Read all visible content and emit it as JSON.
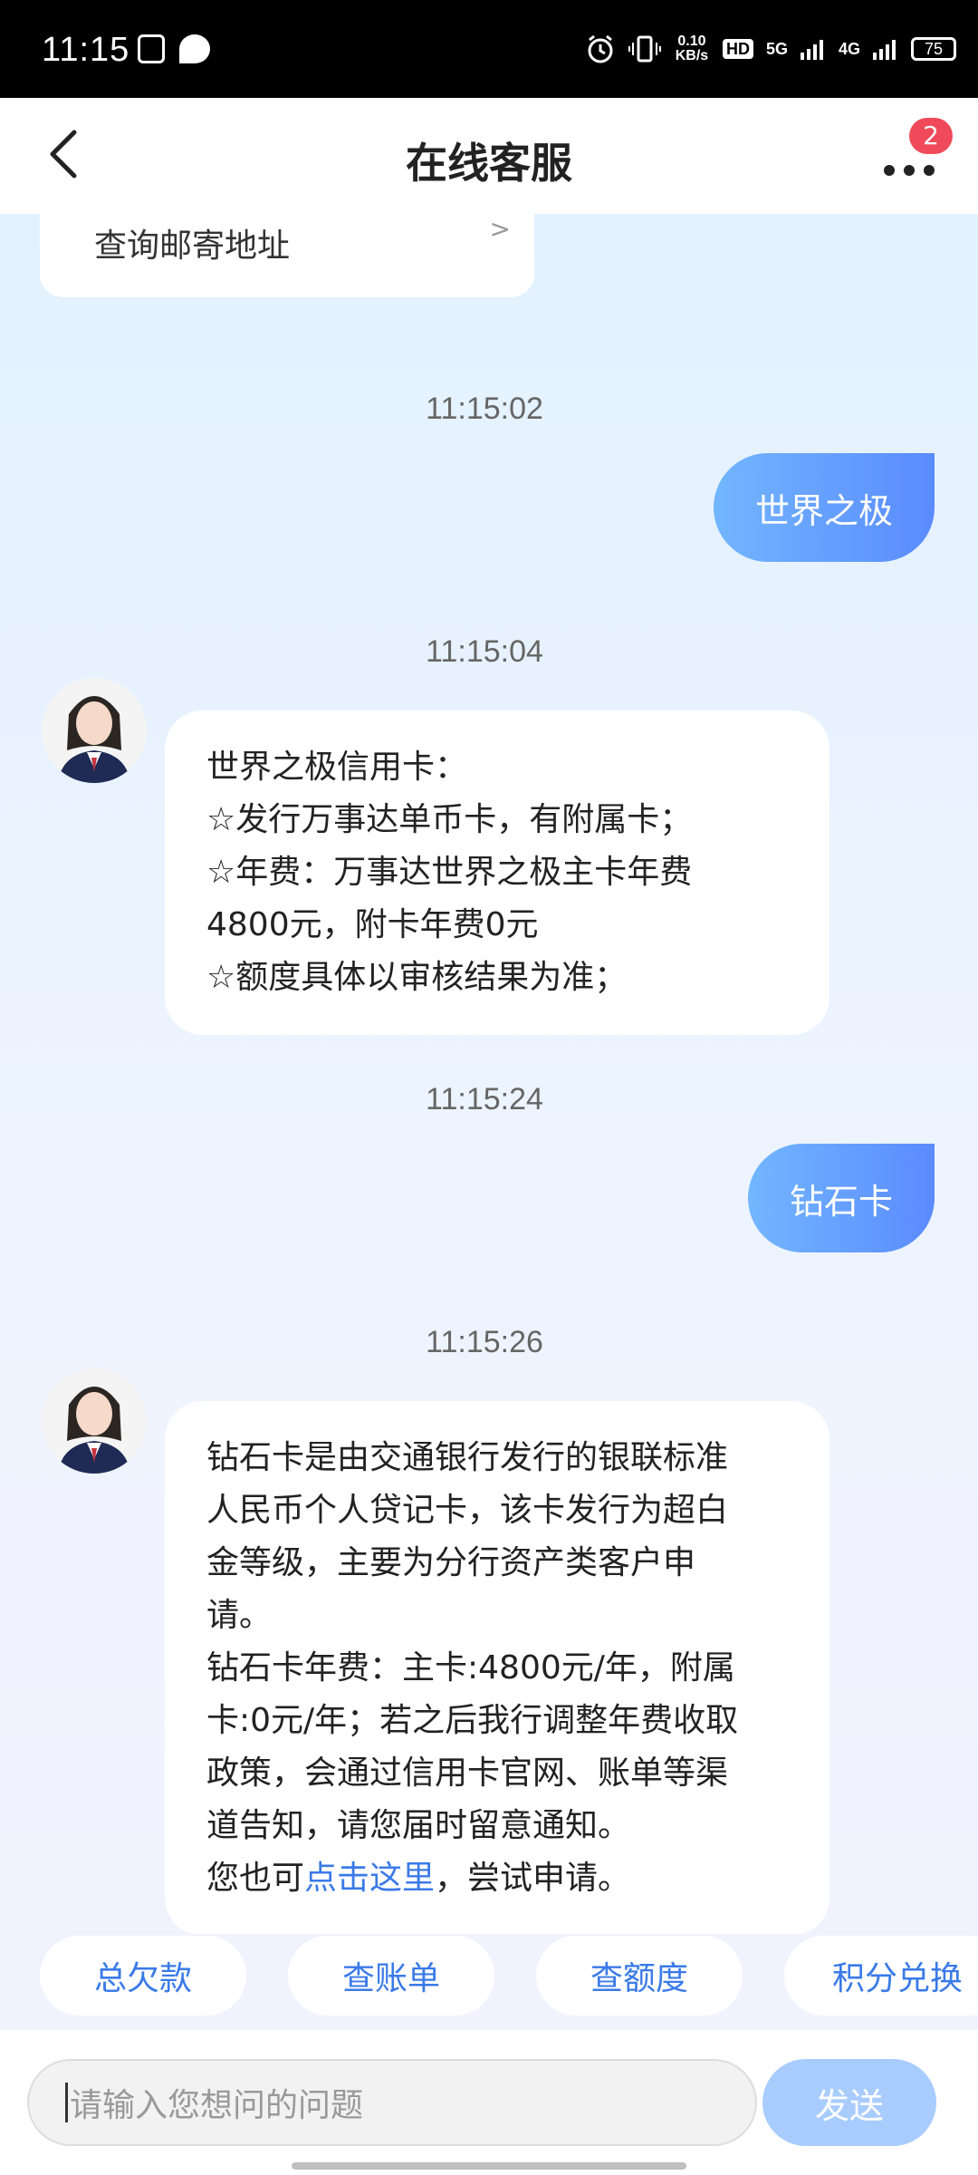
{
  "status_bar": {
    "time": "11:15",
    "net_speed": "0.10 KB/s",
    "hd_label": "HD",
    "signal_5g": "5G",
    "signal_4g": "4G",
    "battery": "75"
  },
  "header": {
    "title": "在线客服",
    "badge_count": "2"
  },
  "chat": {
    "partial_card_text": "查询邮寄地址",
    "messages": [
      {
        "timestamp": "11:15:02",
        "role": "user",
        "text": "世界之极"
      },
      {
        "timestamp": "11:15:04",
        "role": "bot",
        "lines": [
          "世界之极信用卡：",
          "☆发行万事达单币卡，有附属卡；",
          "☆年费：万事达世界之极主卡年费",
          "4800元，附卡年费0元",
          "☆额度具体以审核结果为准；"
        ]
      },
      {
        "timestamp": "11:15:24",
        "role": "user",
        "text": "钻石卡"
      },
      {
        "timestamp": "11:15:26",
        "role": "bot",
        "lines": [
          "钻石卡是由交通银行发行的银联标准",
          "人民币个人贷记卡，该卡发行为超白",
          "金等级，主要为分行资产类客户申",
          "请。",
          "钻石卡年费：主卡:4800元/年，附属",
          "卡:0元/年；若之后我行调整年费收取",
          "政策，会通过信用卡官网、账单等渠",
          "道告知，请您届时留意通知。"
        ],
        "last_line_prefix": "您也可",
        "last_line_link": "点击这里",
        "last_line_suffix": "，尝试申请。"
      }
    ]
  },
  "quick_actions": [
    "总欠款",
    "查账单",
    "查额度",
    "积分兑换"
  ],
  "input": {
    "placeholder": "请输入您想问的问题",
    "send_label": "发送"
  },
  "colors": {
    "accent": "#3a7ae8",
    "user_bubble_start": "#72b6ff",
    "user_bubble_end": "#5a8bff",
    "badge": "#f04a5a",
    "send_disabled": "#a9ccff"
  }
}
